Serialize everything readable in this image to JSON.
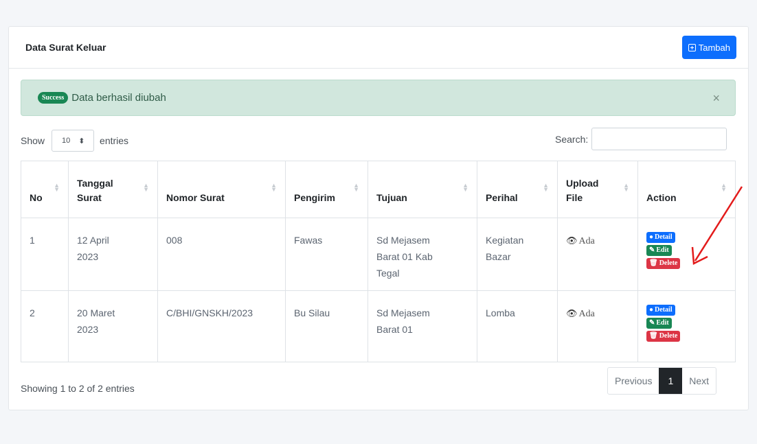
{
  "card": {
    "title": "Data Surat Keluar",
    "add_label": "Tambah"
  },
  "alert": {
    "badge": "Success",
    "message": "Data berhasil diubah",
    "close": "×"
  },
  "length": {
    "show": "Show",
    "value": "10",
    "arrow": "⬍",
    "entries": "entries"
  },
  "search": {
    "label": "Search:",
    "value": ""
  },
  "table": {
    "headers": [
      "No",
      "Tanggal Surat",
      "Nomor Surat",
      "Pengirim",
      "Tujuan",
      "Perihal",
      "Upload File",
      "Action"
    ],
    "rows": [
      {
        "no": "1",
        "tanggal": "12 April 2023",
        "nomor": "008",
        "pengirim": "Fawas",
        "tujuan": "Sd Mejasem Barat 01 Kab Tegal",
        "perihal": "Kegiatan Bazar",
        "file": "Ada"
      },
      {
        "no": "2",
        "tanggal": "20 Maret 2023",
        "nomor": "C/BHI/GNSKH/2023",
        "pengirim": "Bu Silau",
        "tujuan": "Sd Mejasem Barat 01",
        "perihal": "Lomba",
        "file": "Ada"
      }
    ],
    "actions": {
      "detail": "Detail",
      "edit": "Edit",
      "delete": "Delete"
    }
  },
  "footer": {
    "info": "Showing 1 to 2 of 2 entries"
  },
  "pagination": {
    "previous": "Previous",
    "current": "1",
    "next": "Next"
  },
  "colors": {
    "primary": "#0d6efd",
    "success": "#198754",
    "danger": "#dc3545",
    "annotation_arrow": "#e31b1b"
  },
  "icons": {
    "add": "plus-square-icon",
    "view": "eye-icon",
    "edit": "edit-icon",
    "delete": "trash-icon",
    "sort": "sort-icon"
  }
}
